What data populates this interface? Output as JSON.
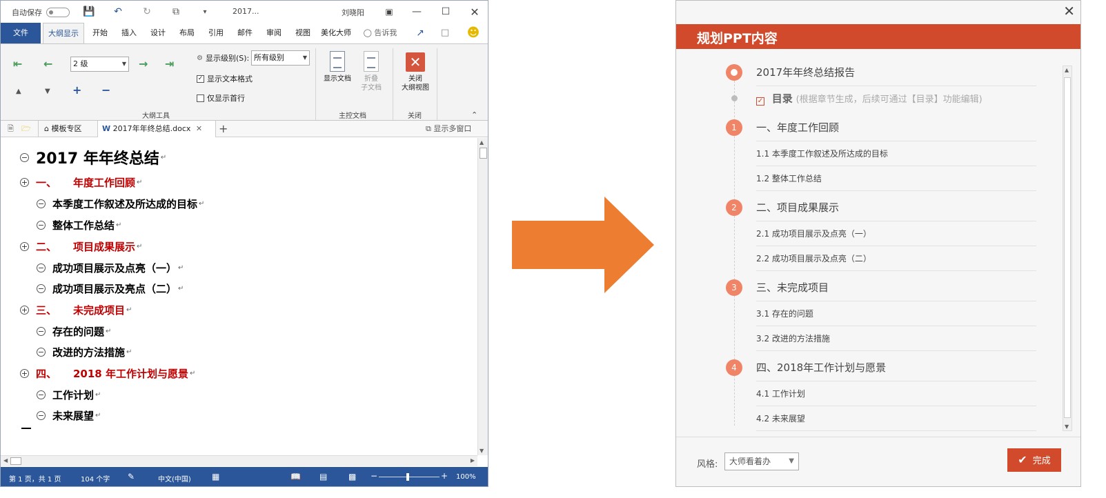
{
  "word": {
    "titlebar": {
      "autosave": "自动保存",
      "doc_title": "2017...",
      "user": "刘晓阳"
    },
    "ribbon_tabs": [
      "文件",
      "大纲显示",
      "开始",
      "插入",
      "设计",
      "布局",
      "引用",
      "邮件",
      "审阅",
      "视图",
      "美化大师"
    ],
    "tell_me": "告诉我",
    "outline_tools": {
      "level_value": "2 级",
      "show_level_label": "显示级别(S):",
      "show_level_value": "所有级别",
      "show_text_format": "显示文本格式",
      "first_line_only": "仅显示首行",
      "group_label": "大纲工具",
      "show_text_format_checked": true,
      "first_line_only_checked": false
    },
    "master_doc": {
      "show_doc": "显示文档",
      "collapse_line1": "折叠",
      "collapse_line2": "子文档",
      "group_label": "主控文档"
    },
    "close_group": {
      "close_line1": "关闭",
      "close_line2": "大纲视图",
      "group_label": "关闭"
    },
    "doc_tabs": {
      "template_zone": "模板专区",
      "document": "2017年年终总结.docx",
      "multi_window": "显示多窗口"
    },
    "outline": [
      {
        "level": 0,
        "marker": "−",
        "text": "2017 年年终总结"
      },
      {
        "level": 1,
        "marker": "+",
        "num": "一、",
        "text": "年度工作回顾"
      },
      {
        "level": 2,
        "marker": "−",
        "text": "本季度工作叙述及所达成的目标"
      },
      {
        "level": 2,
        "marker": "−",
        "text": "整体工作总结"
      },
      {
        "level": 1,
        "marker": "+",
        "num": "二、",
        "text": "项目成果展示"
      },
      {
        "level": 2,
        "marker": "−",
        "text": "成功项目展示及点亮（一）"
      },
      {
        "level": 2,
        "marker": "−",
        "text": "成功项目展示及亮点（二）"
      },
      {
        "level": 1,
        "marker": "+",
        "num": "三、",
        "text": "未完成项目"
      },
      {
        "level": 2,
        "marker": "−",
        "text": "存在的问题"
      },
      {
        "level": 2,
        "marker": "−",
        "text": "改进的方法措施"
      },
      {
        "level": 1,
        "marker": "+",
        "num": "四、",
        "text": "2018 年工作计划与愿景"
      },
      {
        "level": 2,
        "marker": "−",
        "text": "工作计划"
      },
      {
        "level": 2,
        "marker": "−",
        "text": "未来展望"
      }
    ],
    "status": {
      "page": "第 1 页，共 1 页",
      "words": "104 个字",
      "language": "中文(中国)",
      "zoom": "100%"
    }
  },
  "dialog": {
    "title": "规划PPT内容",
    "report_title": "2017年年终总结报告",
    "toc_label": "目录",
    "toc_hint": "(根据章节生成，后续可通过【目录】功能编辑)",
    "toc_checked": true,
    "sections": [
      {
        "num": "1",
        "title": "一、年度工作回顾",
        "items": [
          "1.1 本季度工作叙述及所达成的目标",
          "1.2 整体工作总结"
        ]
      },
      {
        "num": "2",
        "title": "二、项目成果展示",
        "items": [
          "2.1 成功项目展示及点亮（一）",
          "2.2 成功项目展示及点亮（二）"
        ]
      },
      {
        "num": "3",
        "title": "三、未完成项目",
        "items": [
          "3.1 存在的问题",
          "3.2 改进的方法措施"
        ]
      },
      {
        "num": "4",
        "title": "四、2018年工作计划与愿景",
        "items": [
          "4.1 工作计划",
          "4.2 未来展望"
        ]
      }
    ],
    "style_label": "风格:",
    "style_value": "大师看着办",
    "done_label": "完成"
  },
  "colors": {
    "word_blue": "#2b579a",
    "heading_red": "#c00000",
    "dialog_red": "#d04a2b",
    "badge_orange": "#f08466",
    "arrow_orange": "#ed7d31"
  }
}
